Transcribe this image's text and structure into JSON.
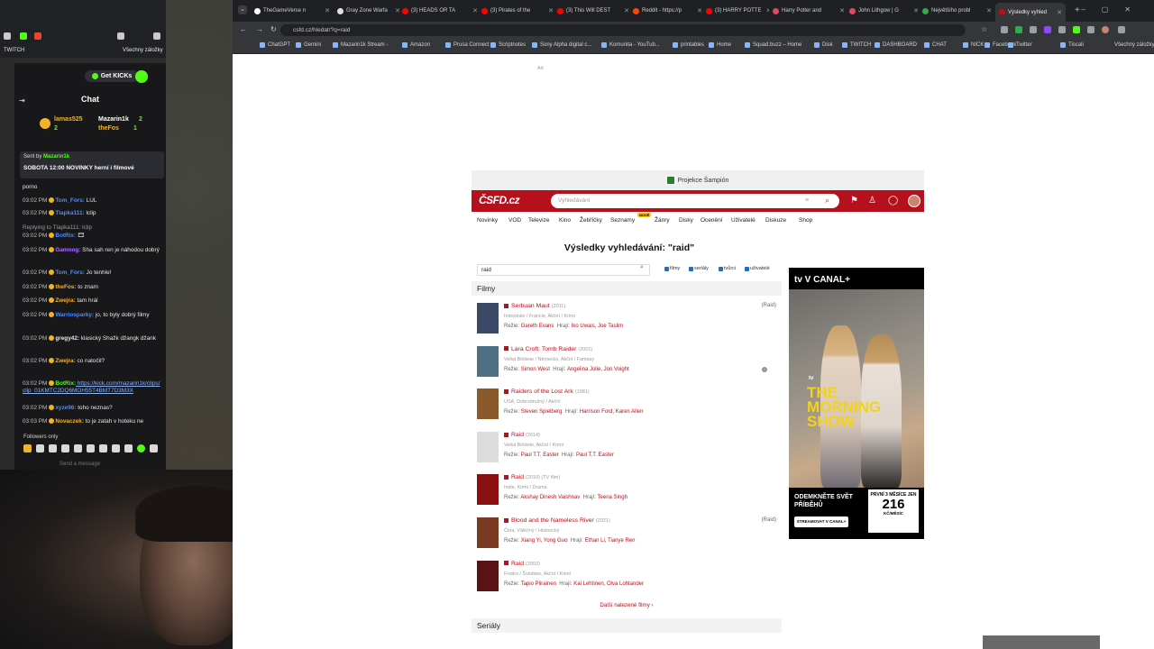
{
  "stream": {
    "kick_tab": "TWITCH",
    "all_bookmarks": "Všechny záložky",
    "get_kicks": "Get KICKs",
    "chat_title": "Chat",
    "leaders": [
      {
        "name": "lamas525",
        "value": "2",
        "color": "#f0b429"
      },
      {
        "name": "Mazarin1k",
        "value": "2",
        "color": "#ffffff"
      },
      {
        "name": "theFos",
        "value": "1",
        "color": "#f0b429"
      }
    ],
    "pinned_by": "Sent by",
    "pinned_author": "Mazarin1k",
    "pinned_msg": "SOBOTA 12:00 NOVINKY herní i filmové",
    "messages": [
      {
        "time": "",
        "user": "",
        "text": "porno",
        "ucolor": "#e6e6e6"
      },
      {
        "time": "03:02 PM",
        "user": "Tom_Fors:",
        "text": " LUL",
        "ucolor": "#4a8cff"
      },
      {
        "time": "03:02 PM",
        "user": "Tlapka111:",
        "text": " lclip",
        "ucolor": "#4a8cff"
      },
      {
        "time": "",
        "user": "",
        "text": "Replying to Tlapka111: lclip",
        "ucolor": "#999999"
      },
      {
        "time": "03:02 PM",
        "user": "BotRix:",
        "text": " 🎞",
        "ucolor": "#4a8cff"
      },
      {
        "time": "03:02 PM",
        "user": "Gamnog:",
        "text": " Sha sah ren je náhodou dobrý",
        "ucolor": "#a970ff"
      },
      {
        "time": "03:02 PM",
        "user": "Tom_Fors:",
        "text": " Jo tenhle!",
        "ucolor": "#4a8cff"
      },
      {
        "time": "03:02 PM",
        "user": "theFos:",
        "text": " to znam",
        "ucolor": "#f0b429"
      },
      {
        "time": "03:02 PM",
        "user": "Zwejra:",
        "text": " tam hrál",
        "ucolor": "#f0b429"
      },
      {
        "time": "03:02 PM",
        "user": "Warriosparky:",
        "text": " jo, to byly dobrý filmy",
        "ucolor": "#4a8cff"
      },
      {
        "time": "03:02 PM",
        "user": "gregy42:",
        "text": " klasický Shažk džangk džank",
        "ucolor": "#e6e6e6"
      },
      {
        "time": "03:02 PM",
        "user": "Zwejra:",
        "text": " co natočil?",
        "ucolor": "#f0b429"
      },
      {
        "time": "03:02 PM",
        "user": "BotRix:",
        "text": " https://kick.com/mazarin1k/clips/clip_01KMTC2DQ6MOH55T4BMT7D3M3X",
        "ucolor": "#53fc18"
      },
      {
        "time": "03:02 PM",
        "user": "xyze96:",
        "text": " toho neznas?",
        "ucolor": "#4a8cff"
      },
      {
        "time": "03:03 PM",
        "user": "Novaczek:",
        "text": " to je zatah v hoteku ne",
        "ucolor": "#f0b429"
      }
    ],
    "followers_only": "Followers only",
    "send_placeholder": "Send a message"
  },
  "browser": {
    "tabs": [
      {
        "label": "TheGameVerse n",
        "color": "#ffffff"
      },
      {
        "label": "Gray Zone Warfa",
        "color": "#e0e0e0"
      },
      {
        "label": "(3) HEADS OR TA",
        "color": "#ff0000"
      },
      {
        "label": "(3) Pirates of the",
        "color": "#ff0000"
      },
      {
        "label": "(3) This Will DEST",
        "color": "#ff0000"
      },
      {
        "label": "Reddit - https://p",
        "color": "#ff4500"
      },
      {
        "label": "(3) HARRY POTTE",
        "color": "#ff0000"
      },
      {
        "label": "Harry Potter and",
        "color": "#e04a5c"
      },
      {
        "label": "John Lithgow | G",
        "color": "#e04a5c"
      },
      {
        "label": "Největšího probl",
        "color": "#34a853"
      },
      {
        "label": "Výsledky vyhled",
        "color": "#b5101b"
      }
    ],
    "url": "csfd.cz/hledat/?q=raid",
    "bookmarks": [
      "ChatGPT",
      "Gemini",
      "Mazarin1k Stream -",
      "Amazon",
      "Prusa Connect",
      "Scriptnotes",
      "Sony Alpha digital c...",
      "Komunita - YouTub...",
      "printables",
      "Home",
      "Squad.buzz – Home",
      "Disk",
      "TWITCH",
      "DASHBOARD",
      "CHAT",
      "NICK",
      "Facebook",
      "Twitter",
      "Tiscali"
    ],
    "all_bookmarks": "Všechny záložky"
  },
  "page": {
    "ad_top": "Ad",
    "projection_bar": "Projekce Šampión",
    "logo": "ČSFD.cz",
    "search_placeholder": "Vyhledávání",
    "nav": [
      "Novinky",
      "VOD",
      "Televize",
      "Kino",
      "Žebříčky",
      "Seznamy",
      "Žánry",
      "Disky",
      "Ocenění",
      "Uživatelé",
      "Diskuze",
      "Shop"
    ],
    "nav_badge": "NOVÉ",
    "results_title": "Výsledky vyhledávání: \"raid\"",
    "query": "raid",
    "filters": [
      "filmy",
      "seriály",
      "tvůrci",
      "uživatelé"
    ],
    "films_heading": "Filmy",
    "films": [
      {
        "title": "Serbuan Maut",
        "year": "(2011)",
        "meta": "Indonésie / Francie, Akční / Krimi",
        "director": "Gareth Evans",
        "actors": "Iko Uwais, Joe Taslim",
        "tag": "(Raid)",
        "poster": "#3a4a66"
      },
      {
        "title": "Lara Croft: Tomb Raider",
        "year": "(2001)",
        "meta": "Velká Británie / Německo, Akční / Fantasy",
        "director": "Simon West",
        "actors": "Angelina Jolie, Jon Voight",
        "tag": "",
        "poster": "#4f6f82"
      },
      {
        "title": "Raiders of the Lost Ark",
        "year": "(1981)",
        "meta": "USA, Dobrodružný / Akční",
        "director": "Steven Spielberg",
        "actors": "Harrison Ford, Karen Allen",
        "tag": "",
        "poster": "#8a5a2b"
      },
      {
        "title": "Raid",
        "year": "(2014)",
        "meta": "Velká Británie, Akční / Krimi",
        "director": "Paul T.T. Easter",
        "actors": "Paul T.T. Easter",
        "tag": "",
        "poster": "#dcdcdc"
      },
      {
        "title": "Raid",
        "year": "(2010) (TV film)",
        "meta": "Indie, Krimi / Drama",
        "director": "Akshay Dinesh Vaishnav",
        "actors": "Teena Singh",
        "tag": "",
        "poster": "#8a1010"
      },
      {
        "title": "Blood and the Nameless River",
        "year": "(2021)",
        "meta": "Čína, Válečný / Historický",
        "director": "Xiang Yi, Yong Guo",
        "actors": "Ethan Li, Tianye Ren",
        "tag": "(Raid)",
        "poster": "#7a3a22"
      },
      {
        "title": "Raid",
        "year": "(2003)",
        "meta": "Finsko / Švédsko, Akční / Krimi",
        "director": "Tapio Piirainen",
        "actors": "Kai Lehtinen, Olva Lohtander",
        "tag": "",
        "poster": "#5a1212"
      }
    ],
    "director_label": "Režie:",
    "actors_label": "Hrají:",
    "more_films": "Další nalezené filmy ›",
    "serials_heading": "Seriály",
    "ad_label": "Ad",
    "side_ad": {
      "brand": "tv  V CANAL+",
      "show_prefix": "tv",
      "show": "THE MORNING SHOW",
      "copy": "ODEMKNĚTE SVĚT PŘÍBĚHŮ",
      "cta": "STREAMOVAT V CANAL+",
      "price_top": "PRVNÍ 3 MĚSÍCE JEN",
      "price": "216",
      "price_unit": "KČ/MĚSÍC"
    }
  }
}
